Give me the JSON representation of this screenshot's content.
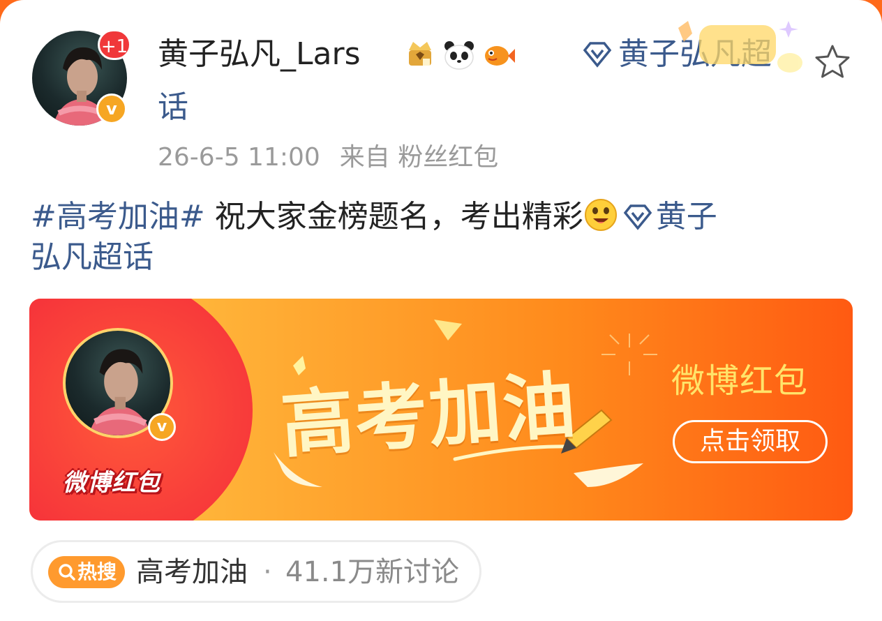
{
  "post": {
    "avatar_notification": "+1",
    "verified_mark": "v",
    "username": "黄子弘凡_Lars",
    "supertopic_icon": "diamond-icon",
    "supertopic_part1": "黄子弘凡超",
    "supertopic_part2": "话",
    "timestamp": "26-6-5 11:00",
    "source": "来自 粉丝红包",
    "hashtag": "#高考加油#",
    "text": " 祝大家金榜题名，考出精彩",
    "trailing_topic_part1": "黄子",
    "trailing_topic_part2": "弘凡超话"
  },
  "banner": {
    "logo": "微博红包",
    "slogan": "高考加油",
    "brand": "微博红包",
    "button": "点击领取"
  },
  "hot": {
    "badge": "热搜",
    "topic": "高考加油",
    "separator": "·",
    "count": "41.1万新讨论"
  },
  "colors": {
    "link_blue": "#3b5a8c",
    "header_orange": "#ff6a1a",
    "verified_gold": "#f6a623",
    "notification_red": "#f0383a"
  },
  "icons": [
    "crown-medal-icon",
    "panda-icon",
    "goldfish-icon",
    "diamond-icon",
    "star-icon",
    "search-icon",
    "grin-emoji-icon"
  ]
}
